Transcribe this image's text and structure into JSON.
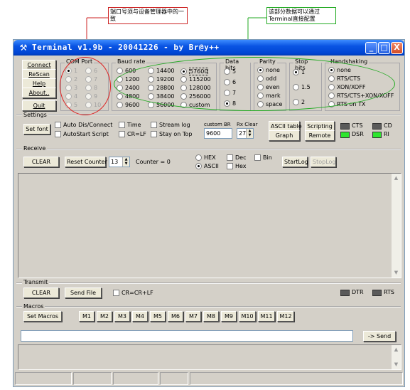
{
  "annotations": {
    "left": "端口号须与设备管理器中的一致",
    "right": "该部分数据可以通过Terminal直接配置"
  },
  "window": {
    "title": "Terminal v1.9b - 20041226 - by Br@y++",
    "controls": [
      "_",
      "□",
      "X"
    ]
  },
  "buttons": {
    "connect": "Connect",
    "rescan": "ReScan",
    "help": "Help",
    "about": "About..",
    "quit": "Quit"
  },
  "com_port": {
    "label": "COM Port",
    "ports": [
      "1",
      "2",
      "3",
      "4",
      "5",
      "6",
      "7",
      "8",
      "9",
      "10"
    ]
  },
  "baud_rate": {
    "label": "Baud rate",
    "rates": [
      "600",
      "1200",
      "2400",
      "4800",
      "9600",
      "14400",
      "19200",
      "28800",
      "38400",
      "56000",
      "57600",
      "115200",
      "128000",
      "256000",
      "custom"
    ],
    "selected": "57600"
  },
  "data_bits": {
    "label": "Data bits",
    "options": [
      "5",
      "6",
      "7",
      "8"
    ],
    "selected": "8"
  },
  "parity": {
    "label": "Parity",
    "options": [
      "none",
      "odd",
      "even",
      "mark",
      "space"
    ],
    "selected": "none"
  },
  "stop_bits": {
    "label": "Stop bits",
    "options": [
      "1",
      "1.5",
      "2"
    ],
    "selected": "1"
  },
  "handshaking": {
    "label": "Handshaking",
    "options": [
      "none",
      "RTS/CTS",
      "XON/XOFF",
      "RTS/CTS+XON/XOFF",
      "RTS on TX"
    ],
    "selected": "none"
  },
  "settings": {
    "label": "Settings",
    "set_font": "Set font",
    "auto_dis": "Auto Dis/Connect",
    "autostart": "AutoStart Script",
    "time": "Time",
    "crlf": "CR=LF",
    "stream_log": "Stream log",
    "stay_on_top": "Stay on Top",
    "custom_br_label": "custom BR",
    "custom_br_value": "9600",
    "rx_clear_label": "Rx Clear",
    "rx_clear_value": "27",
    "ascii_table": "ASCII table",
    "graph": "Graph",
    "scripting": "Scripting",
    "remote": "Remote",
    "cts": "CTS",
    "cd": "CD",
    "dsr": "DSR",
    "ri": "RI"
  },
  "receive": {
    "label": "Receive",
    "clear": "CLEAR",
    "reset_counter": "Reset Counter",
    "counter_value": "13",
    "counter_text": "Counter = 0",
    "hex": "HEX",
    "ascii": "ASCII",
    "dec": "Dec",
    "hex2": "Hex",
    "bin": "Bin",
    "startlog": "StartLog",
    "stoplog": "StopLog"
  },
  "transmit": {
    "label": "Transmit",
    "clear": "CLEAR",
    "send_file": "Send File",
    "crcrlf": "CR=CR+LF",
    "dtr": "DTR",
    "rts": "RTS"
  },
  "macros": {
    "label": "Macros",
    "set_macros": "Set Macros",
    "items": [
      "M1",
      "M2",
      "M3",
      "M4",
      "M5",
      "M6",
      "M7",
      "M8",
      "M9",
      "M10",
      "M11",
      "M12"
    ]
  },
  "send": {
    "button": "-> Send",
    "input_value": ""
  },
  "colors": {
    "titlebar": "#0a54e3",
    "annot_red": "#cc2222",
    "annot_green": "#22aa22",
    "led_on": "#2ee62e"
  }
}
